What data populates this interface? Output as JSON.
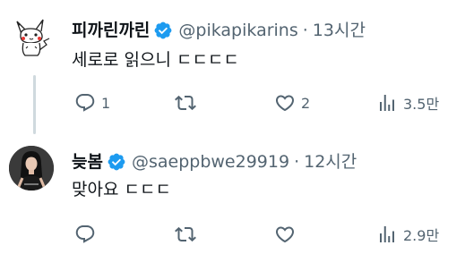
{
  "tweets": [
    {
      "display_name": "피까린까린",
      "handle": "@pikapikarins",
      "separator": "·",
      "time": "13시간",
      "text": "세로로 읽으니 ㄷㄷㄷㄷ",
      "actions": {
        "reply_count": "1",
        "retweet_count": "",
        "like_count": "2",
        "views_count": "3.5만"
      },
      "avatar_icon": "pikachu-sketch-avatar"
    },
    {
      "display_name": "늦봄",
      "handle": "@saeppbwe29919",
      "separator": "·",
      "time": "12시간",
      "text": "맞아요 ㄷㄷㄷ",
      "actions": {
        "reply_count": "",
        "retweet_count": "",
        "like_count": "",
        "views_count": "2.9만"
      },
      "avatar_icon": "person-photo-avatar"
    }
  ],
  "colors": {
    "text_primary": "#0f1419",
    "text_secondary": "#536471",
    "verified_blue": "#1d9bf0",
    "thread_line": "#cfd9de"
  },
  "icons": [
    "verified-badge-icon",
    "reply-icon",
    "retweet-icon",
    "like-icon",
    "views-icon"
  ]
}
